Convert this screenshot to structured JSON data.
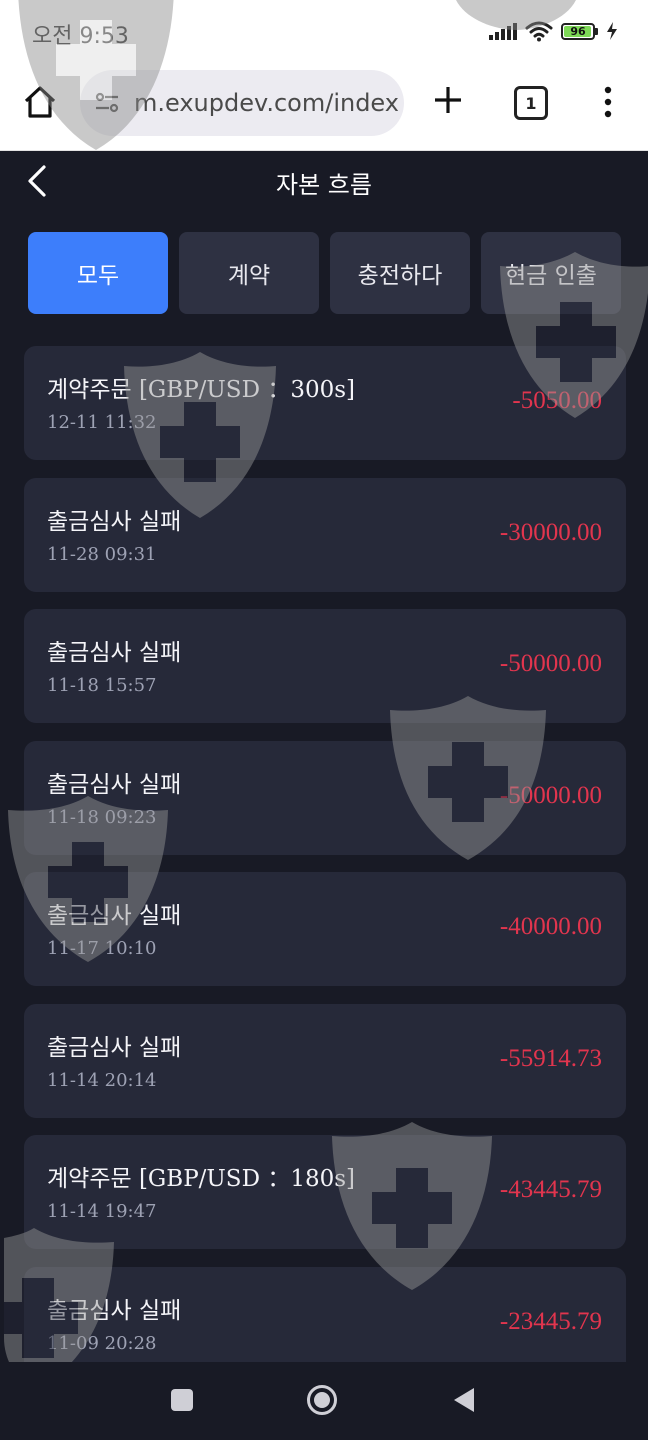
{
  "status_bar": {
    "time": "오전 9:53",
    "battery": "96",
    "battery_level": 0.96
  },
  "browser": {
    "url": "m.exupdev.com/index",
    "tab_count": "1"
  },
  "app": {
    "title": "자본 흐름"
  },
  "tabs": [
    {
      "label": "모두",
      "active": true
    },
    {
      "label": "계약",
      "active": false
    },
    {
      "label": "충전하다",
      "active": false
    },
    {
      "label": "현금 인출",
      "active": false
    }
  ],
  "records": [
    {
      "title": "계약주문 [GBP/USD ：300s]",
      "time": "12-11 11:32",
      "amount": "-5050.00"
    },
    {
      "title": "출금심사 실패",
      "time": "11-28 09:31",
      "amount": "-30000.00"
    },
    {
      "title": "출금심사 실패",
      "time": "11-18 15:57",
      "amount": "-50000.00"
    },
    {
      "title": "출금심사 실패",
      "time": "11-18 09:23",
      "amount": "-50000.00"
    },
    {
      "title": "출금심사 실패",
      "time": "11-17 10:10",
      "amount": "-40000.00"
    },
    {
      "title": "출금심사 실패",
      "time": "11-14 20:14",
      "amount": "-55914.73"
    },
    {
      "title": "계약주문 [GBP/USD ：180s]",
      "time": "11-14 19:47",
      "amount": "-43445.79"
    },
    {
      "title": "출금심사 실패",
      "time": "11-09 20:28",
      "amount": "-23445.79"
    }
  ],
  "colors": {
    "accent": "#3d7efb",
    "negative": "#e2354e",
    "card": "#262939",
    "background": "#181a25"
  }
}
